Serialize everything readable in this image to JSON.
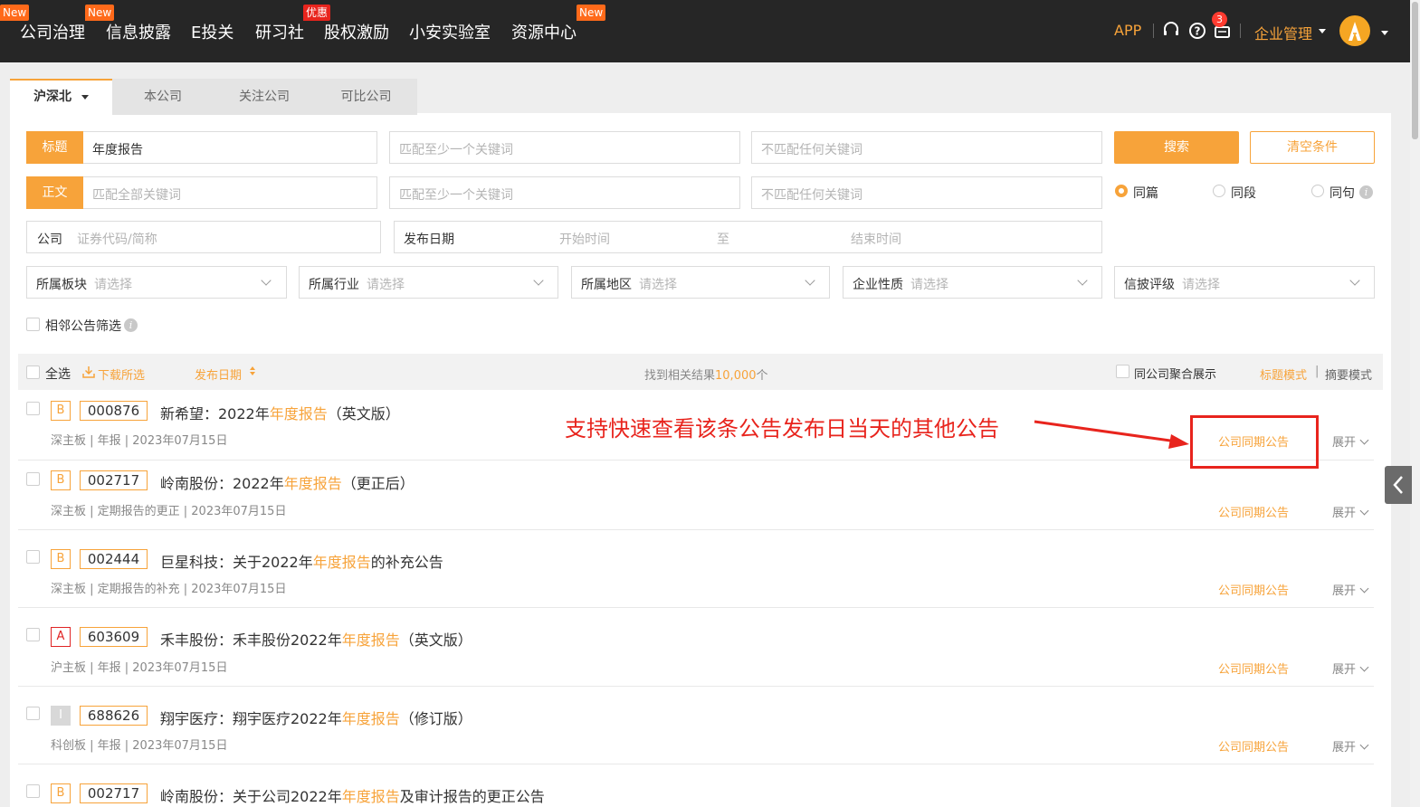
{
  "nav": {
    "items": [
      {
        "label": "公司治理",
        "badge": "New"
      },
      {
        "label": "信息披露",
        "badge": "New"
      },
      {
        "label": "E投关",
        "badge": ""
      },
      {
        "label": "研习社",
        "badge": "优惠"
      },
      {
        "label": "股权激励",
        "badge": ""
      },
      {
        "label": "小安实验室",
        "badge": ""
      },
      {
        "label": "资源中心",
        "badge": "New"
      }
    ],
    "app": "APP",
    "message_count": "3",
    "corp_mgmt": "企业管理",
    "icons": [
      "headset-icon",
      "help-icon",
      "message-icon",
      "avatar"
    ]
  },
  "tabs": [
    {
      "label": "沪深北",
      "active": true
    },
    {
      "label": "本公司",
      "active": false
    },
    {
      "label": "关注公司",
      "active": false
    },
    {
      "label": "可比公司",
      "active": false
    }
  ],
  "search": {
    "title_tag": "标题",
    "title_value": "年度报告",
    "body_tag": "正文",
    "body_placeholder": "匹配全部关键词",
    "any_placeholder": "匹配至少一个关键词",
    "none_placeholder": "不匹配任何关键词",
    "search_btn": "搜索",
    "clear_btn": "清空条件",
    "scope": [
      "同篇",
      "同段",
      "同句"
    ],
    "company_label": "公司",
    "company_placeholder": "证券代码/简称",
    "date_label": "发布日期",
    "start_placeholder": "开始时间",
    "date_sep": "至",
    "end_placeholder": "结束时间",
    "filters": [
      {
        "label": "所属板块",
        "placeholder": "请选择"
      },
      {
        "label": "所属行业",
        "placeholder": "请选择"
      },
      {
        "label": "所属地区",
        "placeholder": "请选择"
      },
      {
        "label": "企业性质",
        "placeholder": "请选择"
      },
      {
        "label": "信披评级",
        "placeholder": "请选择"
      }
    ],
    "adjacent": "相邻公告筛选"
  },
  "results_header": {
    "select_all": "全选",
    "download": "下载所选",
    "sort": "发布日期",
    "found_prefix": "找到相关结果",
    "found_count": "10,000",
    "found_suffix": "个",
    "merge": "同公司聚合展示",
    "mode_title": "标题模式",
    "mode_sep": "|",
    "mode_summary": "摘要模式"
  },
  "results": [
    {
      "grade": "B",
      "code": "000876",
      "title_pre": "新希望：2022年",
      "title_hl": "年度报告",
      "title_post": "（英文版）",
      "meta": "深主板 | 年报 | 2023年07月15日"
    },
    {
      "grade": "B",
      "code": "002717",
      "title_pre": "岭南股份：2022年",
      "title_hl": "年度报告",
      "title_post": "（更正后）",
      "meta": "深主板 | 定期报告的更正 | 2023年07月15日"
    },
    {
      "grade": "B",
      "code": "002444",
      "title_pre": "巨星科技：关于2022年",
      "title_hl": "年度报告",
      "title_post": "的补充公告",
      "meta": "深主板 | 定期报告的补充 | 2023年07月15日"
    },
    {
      "grade": "A",
      "code": "603609",
      "title_pre": "禾丰股份：禾丰股份2022年",
      "title_hl": "年度报告",
      "title_post": "（英文版）",
      "meta": "沪主板 | 年报 | 2023年07月15日"
    },
    {
      "grade": "I",
      "code": "688626",
      "title_pre": "翔宇医疗：翔宇医疗2022年",
      "title_hl": "年度报告",
      "title_post": "（修订版）",
      "meta": "科创板 | 年报 | 2023年07月15日"
    },
    {
      "grade": "B",
      "code": "002717",
      "title_pre": "岭南股份：关于公司2022年",
      "title_hl": "年度报告",
      "title_post": "及审计报告的更正公告",
      "meta": ""
    }
  ],
  "row_actions": {
    "same_day": "公司同期公告",
    "expand": "展开"
  },
  "annotation": "支持快速查看该条公告发布日当天的其他公告",
  "colors": {
    "accent": "#f7a33a",
    "nav_bg": "#262626",
    "annotation": "#e8241d"
  }
}
